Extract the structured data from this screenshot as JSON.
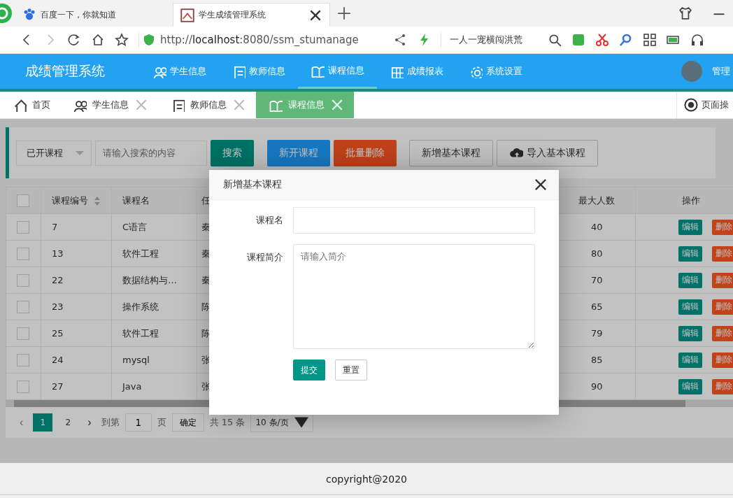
{
  "browser": {
    "tabs": [
      {
        "title": "百度一下，你就知道",
        "selected": false
      },
      {
        "title": "学生成绩管理系统",
        "selected": true
      }
    ],
    "url": "http://**localhost**:8080/ssm_stumanage",
    "search": {
      "value": "一人一宠横闯洪荒"
    }
  },
  "app": {
    "title": "成绩管理系统",
    "nav": [
      {
        "label": "学生信息",
        "selected": false
      },
      {
        "label": "教师信息",
        "selected": false
      },
      {
        "label": "课程信息",
        "selected": true
      },
      {
        "label": "成绩报表",
        "selected": false
      },
      {
        "label": "系统设置",
        "selected": false
      }
    ],
    "user": "管理"
  },
  "page_tabs": [
    {
      "label": "首页",
      "closable": false,
      "selected": false
    },
    {
      "label": "学生信息",
      "closable": true,
      "selected": false
    },
    {
      "label": "教师信息",
      "closable": true,
      "selected": false
    },
    {
      "label": "课程信息",
      "closable": true,
      "selected": true
    }
  ],
  "page_ops": "页面操",
  "toolbar": {
    "filter": "已开课程",
    "search": {
      "placeholder": "请输入搜索的内容"
    },
    "buttons": [
      {
        "label": "搜索",
        "kind": "teal"
      },
      {
        "label": "新开课程",
        "kind": "blue"
      },
      {
        "label": "批量删除",
        "kind": "red"
      },
      {
        "label": "新增基本课程",
        "kind": "plain"
      },
      {
        "label": "导入基本课程",
        "kind": "upload"
      }
    ]
  },
  "table": {
    "all_checked": false,
    "columns": [
      {
        "label": "课程编号",
        "sortable": true
      },
      {
        "label": "课程名",
        "sortable": false
      },
      {
        "label": "任",
        "sortable": false
      },
      {
        "label": "最大人数",
        "sortable": false
      },
      {
        "label": "操作",
        "sortable": false
      }
    ],
    "rows": [
      {
        "checked": false,
        "id": "7",
        "name": "C语言",
        "column_3": "秦",
        "max": "40",
        "actions": [
          "编辑",
          "删除"
        ]
      },
      {
        "checked": false,
        "id": "13",
        "name": "软件工程",
        "column_3": "秦",
        "max": "80",
        "actions": [
          "编辑",
          "删除"
        ]
      },
      {
        "checked": false,
        "id": "22",
        "name": "数据结构与…",
        "column_3": "秦",
        "max": "70",
        "actions": [
          "编辑",
          "删除"
        ]
      },
      {
        "checked": false,
        "id": "23",
        "name": "操作系统",
        "column_3": "陈",
        "max": "65",
        "actions": [
          "编辑",
          "删除"
        ]
      },
      {
        "checked": false,
        "id": "25",
        "name": "软件工程",
        "column_3": "陈",
        "max": "79",
        "actions": [
          "编辑",
          "删除"
        ]
      },
      {
        "checked": false,
        "id": "24",
        "name": "mysql",
        "column_3": "张",
        "max": "85",
        "actions": [
          "编辑",
          "删除"
        ]
      },
      {
        "checked": false,
        "id": "27",
        "name": "Java",
        "column_3": "张",
        "max": "90",
        "actions": [
          "编辑",
          "删除"
        ]
      }
    ]
  },
  "pagination": {
    "prev": {
      "label": "‹",
      "disabled": true
    },
    "next": {
      "label": "›",
      "disabled": false
    },
    "pages": [
      {
        "label": "1",
        "selected": true
      },
      {
        "label": "2",
        "selected": false
      }
    ],
    "goto_label": "到第",
    "goto_value": "1",
    "page_unit": "页",
    "confirm": "确定",
    "total": "共 15 条",
    "page_size": "10 条/页"
  },
  "dialog": {
    "title": "新增基本课程",
    "fields": [
      {
        "label": "课程名",
        "kind": "input"
      },
      {
        "label": "课程简介",
        "kind": "textarea",
        "placeholder": "请输入简介"
      }
    ],
    "buttons": [
      {
        "label": "提交",
        "kind": "primary"
      },
      {
        "label": "重置",
        "kind": "plain"
      }
    ]
  },
  "footer": "copyright@2020"
}
